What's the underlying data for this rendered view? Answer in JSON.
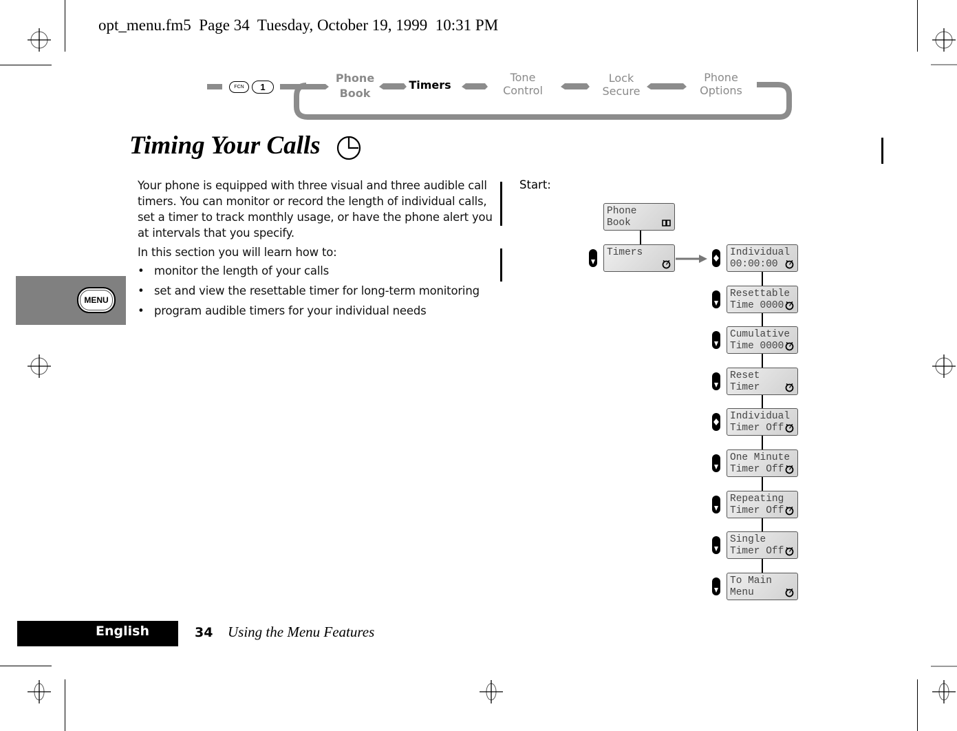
{
  "header": {
    "stamp": "opt_menu.fm5  Page 34  Tuesday, October 19, 1999  10:31 PM"
  },
  "nav": {
    "keys": [
      "FCN",
      "1"
    ],
    "items": [
      {
        "line1": "Phone",
        "line2": "Book",
        "active": false
      },
      {
        "line1": "Timers",
        "line2": "",
        "active": true
      },
      {
        "line1": "Tone",
        "line2": "Control",
        "active": false
      },
      {
        "line1": "Lock",
        "line2": "Secure",
        "active": false
      },
      {
        "line1": "Phone",
        "line2": "Options",
        "active": false
      }
    ]
  },
  "title": {
    "text": "Timing Your Calls",
    "icon": "clock-icon"
  },
  "body": {
    "intro": "Your phone is equipped with three visual and three audible call timers. You can monitor or record the length of individual calls, set a timer to track monthly usage, or have the phone alert you at intervals that you specify.",
    "learn_intro": "In this section you will learn how to:",
    "bullets": [
      "monitor the length of your calls",
      "set and view the resettable timer for long-term monitoring",
      "program audible timers for your individual needs"
    ]
  },
  "side_tab": {
    "key_label": "MENU"
  },
  "diagram": {
    "start_label": "Start:",
    "root": {
      "line1": "Phone",
      "line2": "Book",
      "icon": "book-icon"
    },
    "selected": {
      "line1": "Timers",
      "line2": "",
      "icon": "stopwatch-icon",
      "key": "scroll-down"
    },
    "submenu": [
      {
        "line1": "Individual",
        "line2": "00:00:00",
        "icon": "stopwatch-icon",
        "key": "select"
      },
      {
        "line1": "Resettable",
        "line2": "Time 0000",
        "icon": "stopwatch-icon",
        "key": "scroll-down"
      },
      {
        "line1": "Cumulative",
        "line2": "Time 0000",
        "icon": "stopwatch-icon",
        "key": "scroll-down"
      },
      {
        "line1": "Reset",
        "line2": "Timer",
        "icon": "stopwatch-icon",
        "key": "scroll-down"
      },
      {
        "line1": "Individual",
        "line2": "Timer Off",
        "icon": "stopwatch-icon",
        "key": "select"
      },
      {
        "line1": "One Minute",
        "line2": "Timer Off",
        "icon": "stopwatch-icon",
        "key": "scroll-down"
      },
      {
        "line1": "Repeating",
        "line2": "Timer Off",
        "icon": "stopwatch-icon",
        "key": "scroll-down"
      },
      {
        "line1": "Single",
        "line2": "Timer Off",
        "icon": "stopwatch-icon",
        "key": "scroll-down"
      },
      {
        "line1": "To Main",
        "line2": "Menu",
        "icon": "stopwatch-icon",
        "key": "scroll-down"
      }
    ]
  },
  "footer": {
    "language": "English",
    "page_number": "34",
    "section": "Using the Menu Features"
  },
  "colors": {
    "nav_inactive": "#8a8a8a",
    "ribbon": "#8c8c8c",
    "side_tab": "#808080",
    "screen_border": "#555555"
  }
}
